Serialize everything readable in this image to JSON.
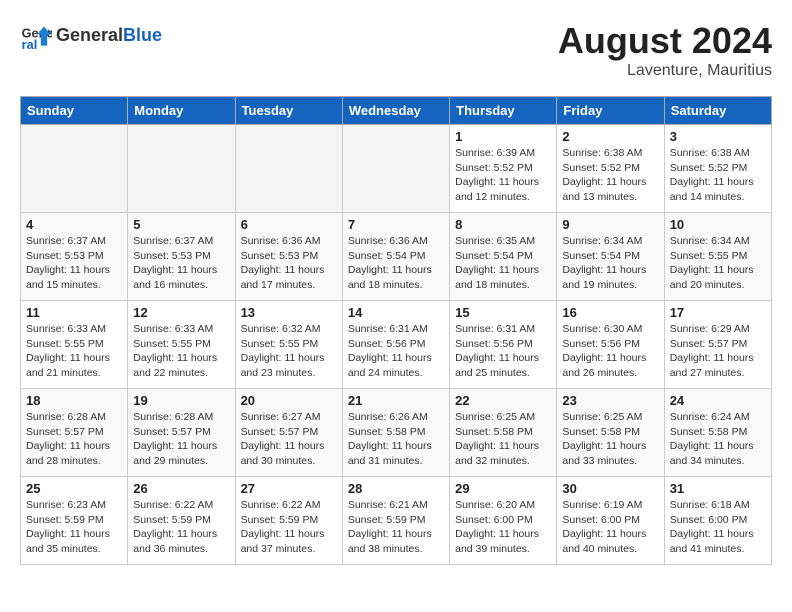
{
  "header": {
    "logo": {
      "general": "General",
      "blue": "Blue"
    },
    "title": "August 2024",
    "location": "Laventure, Mauritius"
  },
  "weekdays": [
    "Sunday",
    "Monday",
    "Tuesday",
    "Wednesday",
    "Thursday",
    "Friday",
    "Saturday"
  ],
  "weeks": [
    [
      {
        "day": "",
        "empty": true
      },
      {
        "day": "",
        "empty": true
      },
      {
        "day": "",
        "empty": true
      },
      {
        "day": "",
        "empty": true
      },
      {
        "day": "1",
        "sunrise": "6:39 AM",
        "sunset": "5:52 PM",
        "daylight": "11 hours and 12 minutes."
      },
      {
        "day": "2",
        "sunrise": "6:38 AM",
        "sunset": "5:52 PM",
        "daylight": "11 hours and 13 minutes."
      },
      {
        "day": "3",
        "sunrise": "6:38 AM",
        "sunset": "5:52 PM",
        "daylight": "11 hours and 14 minutes."
      }
    ],
    [
      {
        "day": "4",
        "sunrise": "6:37 AM",
        "sunset": "5:53 PM",
        "daylight": "11 hours and 15 minutes."
      },
      {
        "day": "5",
        "sunrise": "6:37 AM",
        "sunset": "5:53 PM",
        "daylight": "11 hours and 16 minutes."
      },
      {
        "day": "6",
        "sunrise": "6:36 AM",
        "sunset": "5:53 PM",
        "daylight": "11 hours and 17 minutes."
      },
      {
        "day": "7",
        "sunrise": "6:36 AM",
        "sunset": "5:54 PM",
        "daylight": "11 hours and 18 minutes."
      },
      {
        "day": "8",
        "sunrise": "6:35 AM",
        "sunset": "5:54 PM",
        "daylight": "11 hours and 18 minutes."
      },
      {
        "day": "9",
        "sunrise": "6:34 AM",
        "sunset": "5:54 PM",
        "daylight": "11 hours and 19 minutes."
      },
      {
        "day": "10",
        "sunrise": "6:34 AM",
        "sunset": "5:55 PM",
        "daylight": "11 hours and 20 minutes."
      }
    ],
    [
      {
        "day": "11",
        "sunrise": "6:33 AM",
        "sunset": "5:55 PM",
        "daylight": "11 hours and 21 minutes."
      },
      {
        "day": "12",
        "sunrise": "6:33 AM",
        "sunset": "5:55 PM",
        "daylight": "11 hours and 22 minutes."
      },
      {
        "day": "13",
        "sunrise": "6:32 AM",
        "sunset": "5:55 PM",
        "daylight": "11 hours and 23 minutes."
      },
      {
        "day": "14",
        "sunrise": "6:31 AM",
        "sunset": "5:56 PM",
        "daylight": "11 hours and 24 minutes."
      },
      {
        "day": "15",
        "sunrise": "6:31 AM",
        "sunset": "5:56 PM",
        "daylight": "11 hours and 25 minutes."
      },
      {
        "day": "16",
        "sunrise": "6:30 AM",
        "sunset": "5:56 PM",
        "daylight": "11 hours and 26 minutes."
      },
      {
        "day": "17",
        "sunrise": "6:29 AM",
        "sunset": "5:57 PM",
        "daylight": "11 hours and 27 minutes."
      }
    ],
    [
      {
        "day": "18",
        "sunrise": "6:28 AM",
        "sunset": "5:57 PM",
        "daylight": "11 hours and 28 minutes."
      },
      {
        "day": "19",
        "sunrise": "6:28 AM",
        "sunset": "5:57 PM",
        "daylight": "11 hours and 29 minutes."
      },
      {
        "day": "20",
        "sunrise": "6:27 AM",
        "sunset": "5:57 PM",
        "daylight": "11 hours and 30 minutes."
      },
      {
        "day": "21",
        "sunrise": "6:26 AM",
        "sunset": "5:58 PM",
        "daylight": "11 hours and 31 minutes."
      },
      {
        "day": "22",
        "sunrise": "6:25 AM",
        "sunset": "5:58 PM",
        "daylight": "11 hours and 32 minutes."
      },
      {
        "day": "23",
        "sunrise": "6:25 AM",
        "sunset": "5:58 PM",
        "daylight": "11 hours and 33 minutes."
      },
      {
        "day": "24",
        "sunrise": "6:24 AM",
        "sunset": "5:58 PM",
        "daylight": "11 hours and 34 minutes."
      }
    ],
    [
      {
        "day": "25",
        "sunrise": "6:23 AM",
        "sunset": "5:59 PM",
        "daylight": "11 hours and 35 minutes."
      },
      {
        "day": "26",
        "sunrise": "6:22 AM",
        "sunset": "5:59 PM",
        "daylight": "11 hours and 36 minutes."
      },
      {
        "day": "27",
        "sunrise": "6:22 AM",
        "sunset": "5:59 PM",
        "daylight": "11 hours and 37 minutes."
      },
      {
        "day": "28",
        "sunrise": "6:21 AM",
        "sunset": "5:59 PM",
        "daylight": "11 hours and 38 minutes."
      },
      {
        "day": "29",
        "sunrise": "6:20 AM",
        "sunset": "6:00 PM",
        "daylight": "11 hours and 39 minutes."
      },
      {
        "day": "30",
        "sunrise": "6:19 AM",
        "sunset": "6:00 PM",
        "daylight": "11 hours and 40 minutes."
      },
      {
        "day": "31",
        "sunrise": "6:18 AM",
        "sunset": "6:00 PM",
        "daylight": "11 hours and 41 minutes."
      }
    ]
  ]
}
